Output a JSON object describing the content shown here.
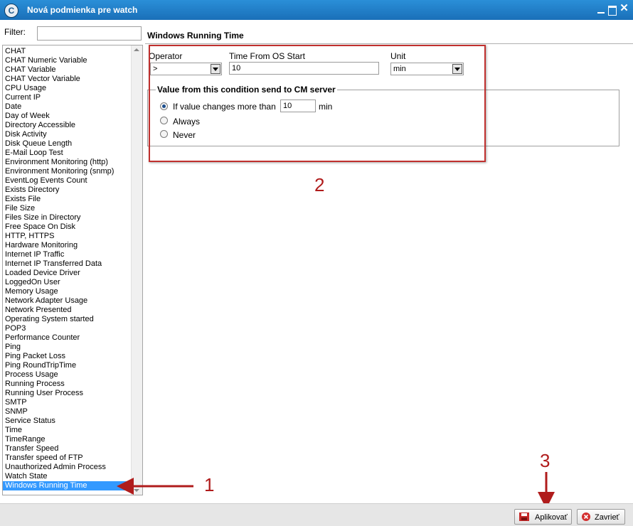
{
  "window": {
    "title": "Nová podmienka pre watch",
    "app_icon": "C"
  },
  "filter": {
    "label": "Filter:",
    "value": ""
  },
  "list": {
    "items": [
      "CHAT",
      "CHAT Numeric Variable",
      "CHAT Variable",
      "CHAT Vector Variable",
      "CPU Usage",
      "Current IP",
      "Date",
      "Day of Week",
      "Directory Accessible",
      "Disk Activity",
      "Disk Queue Length",
      "E-Mail Loop Test",
      "Environment Monitoring (http)",
      "Environment Monitoring (snmp)",
      "EventLog Events Count",
      "Exists Directory",
      "Exists File",
      "File Size",
      "Files Size in Directory",
      "Free Space On Disk",
      "HTTP, HTTPS",
      "Hardware Monitoring",
      "Internet IP Traffic",
      "Internet IP Transferred Data",
      "Loaded Device Driver",
      "LoggedOn User",
      "Memory Usage",
      "Network Adapter Usage",
      "Network Presented",
      "Operating System started",
      "POP3",
      "Performance Counter",
      "Ping",
      "Ping Packet Loss",
      "Ping RoundTripTime",
      "Process Usage",
      "Running Process",
      "Running User Process",
      "SMTP",
      "SNMP",
      "Service Status",
      "Time",
      "TimeRange",
      "Transfer Speed",
      "Transfer speed of FTP",
      "Unauthorized Admin Process",
      "Watch State",
      "Windows Running Time"
    ],
    "selected": "Windows Running Time"
  },
  "condition": {
    "title": "Windows Running Time",
    "operator_label": "Operator",
    "operator_value": ">",
    "time_label": "Time From OS Start",
    "time_value": "10",
    "unit_label": "Unit",
    "unit_value": "min",
    "group_title": "Value from this condition send to CM server",
    "option_changes": "If value changes more than",
    "option_changes_value": "10",
    "option_changes_unit": "min",
    "option_always": "Always",
    "option_never": "Never"
  },
  "annotations": {
    "one": "1",
    "two": "2",
    "three": "3"
  },
  "buttons": {
    "apply": "Aplikovať",
    "close": "Zavrieť"
  },
  "colors": {
    "titlebar": "#1a6fb8",
    "selection": "#3399ff",
    "annotation": "#b01c1c"
  }
}
